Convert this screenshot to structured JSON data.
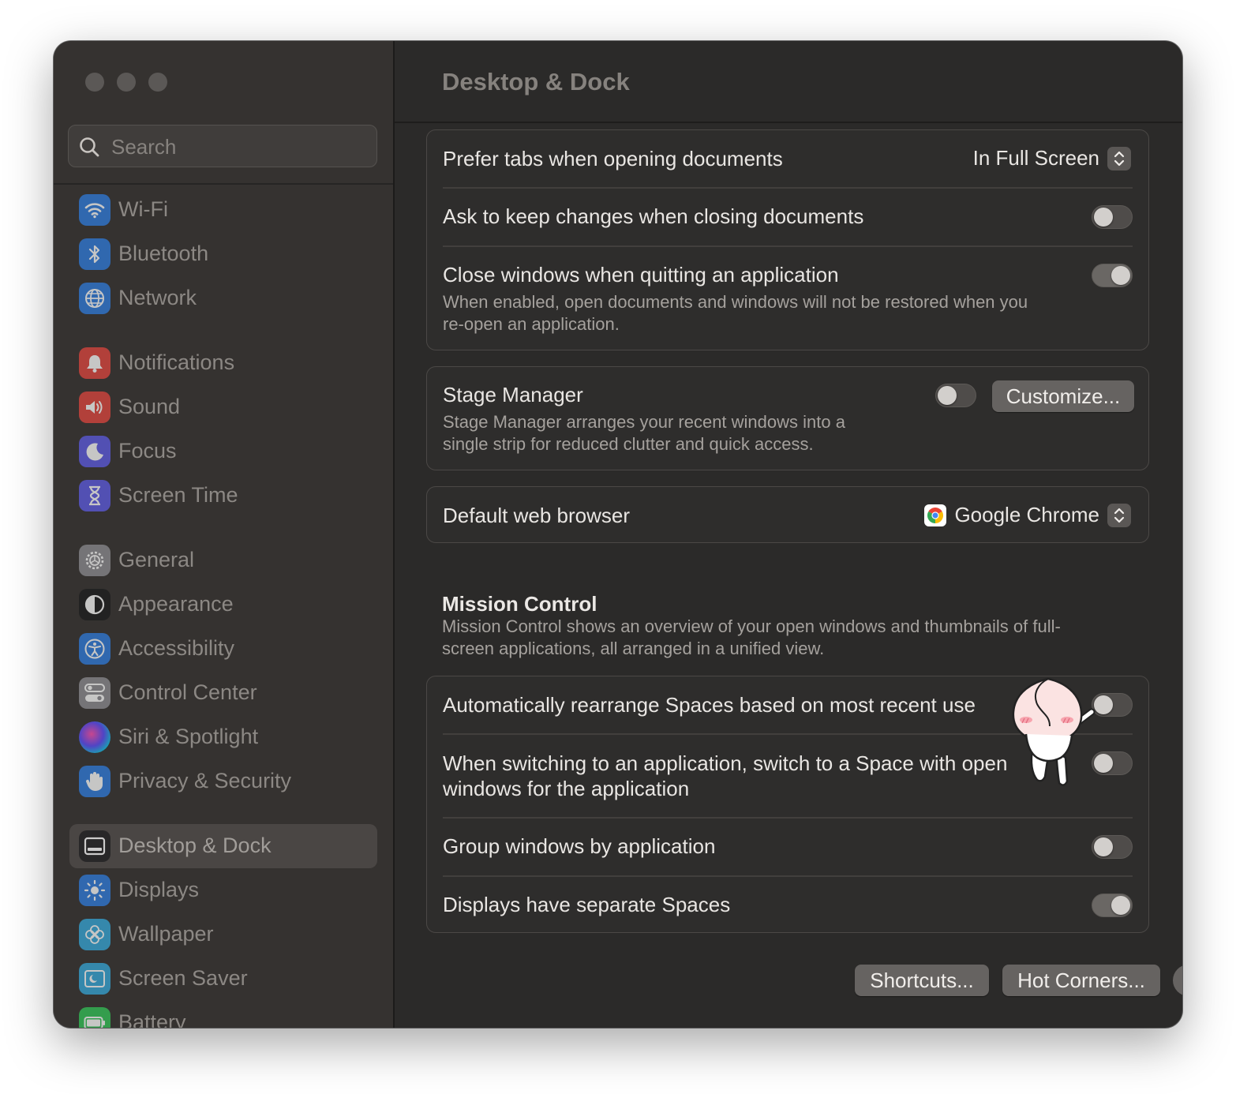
{
  "sidebar": {
    "search_placeholder": "Search",
    "items": [
      {
        "label": "Wi-Fi",
        "icon": "wifi-icon",
        "color": "#2f7de1"
      },
      {
        "label": "Bluetooth",
        "icon": "bluetooth-icon",
        "color": "#2f7de1"
      },
      {
        "label": "Network",
        "icon": "globe-icon",
        "color": "#2f7de1"
      },
      {
        "label": "Notifications",
        "icon": "bell-icon",
        "color": "#e2463f"
      },
      {
        "label": "Sound",
        "icon": "speaker-icon",
        "color": "#e2463f"
      },
      {
        "label": "Focus",
        "icon": "moon-icon",
        "color": "#5e5ce6"
      },
      {
        "label": "Screen Time",
        "icon": "hourglass-icon",
        "color": "#5e5ce6"
      },
      {
        "label": "General",
        "icon": "gear-icon",
        "color": "#8e8e93"
      },
      {
        "label": "Appearance",
        "icon": "appearance-icon",
        "color": "#1c1c1e"
      },
      {
        "label": "Accessibility",
        "icon": "accessibility-icon",
        "color": "#2f7de1"
      },
      {
        "label": "Control Center",
        "icon": "control-center-icon",
        "color": "#8e8e93"
      },
      {
        "label": "Siri & Spotlight",
        "icon": "siri-icon",
        "color": "#3a3a3c"
      },
      {
        "label": "Privacy & Security",
        "icon": "hand-icon",
        "color": "#2f7de1"
      },
      {
        "label": "Desktop & Dock",
        "icon": "dock-icon",
        "color": "#1c1c1e"
      },
      {
        "label": "Displays",
        "icon": "sun-icon",
        "color": "#2f7de1"
      },
      {
        "label": "Wallpaper",
        "icon": "flower-icon",
        "color": "#35aadc"
      },
      {
        "label": "Screen Saver",
        "icon": "screensaver-icon",
        "color": "#35aadc"
      },
      {
        "label": "Battery",
        "icon": "battery-icon",
        "color": "#34c759"
      }
    ],
    "selected": "Desktop & Dock"
  },
  "main": {
    "title": "Desktop & Dock",
    "prefer_tabs": {
      "label": "Prefer tabs when opening documents",
      "value": "In Full Screen"
    },
    "ask_keep_changes": {
      "label": "Ask to keep changes when closing documents",
      "on": false
    },
    "close_windows": {
      "label": "Close windows when quitting an application",
      "desc_line1": "When enabled, open documents and windows will not be restored when you",
      "desc_line2": "re-open an application.",
      "on": true
    },
    "stage_manager": {
      "label": "Stage Manager",
      "desc_line1": "Stage Manager arranges your recent windows into a",
      "desc_line2": "single strip for reduced clutter and quick access.",
      "on": false,
      "customize_label": "Customize..."
    },
    "default_browser": {
      "label": "Default web browser",
      "value": "Google Chrome",
      "icon": "chrome-icon"
    },
    "mission_control": {
      "title": "Mission Control",
      "desc_line1": "Mission Control shows an overview of your open windows and thumbnails of full-",
      "desc_line2": "screen applications, all arranged in a unified view."
    },
    "auto_rearrange": {
      "label": "Automatically rearrange Spaces based on most recent use",
      "on": false
    },
    "switch_space": {
      "label_line1": "When switching to an application, switch to a Space with open",
      "label_line2": "windows for the application",
      "on": false
    },
    "group_windows": {
      "label": "Group windows by application",
      "on": false
    },
    "separate_spaces": {
      "label": "Displays have separate Spaces",
      "on": true
    },
    "shortcuts_label": "Shortcuts...",
    "hot_corners_label": "Hot Corners...",
    "help_label": "?"
  }
}
